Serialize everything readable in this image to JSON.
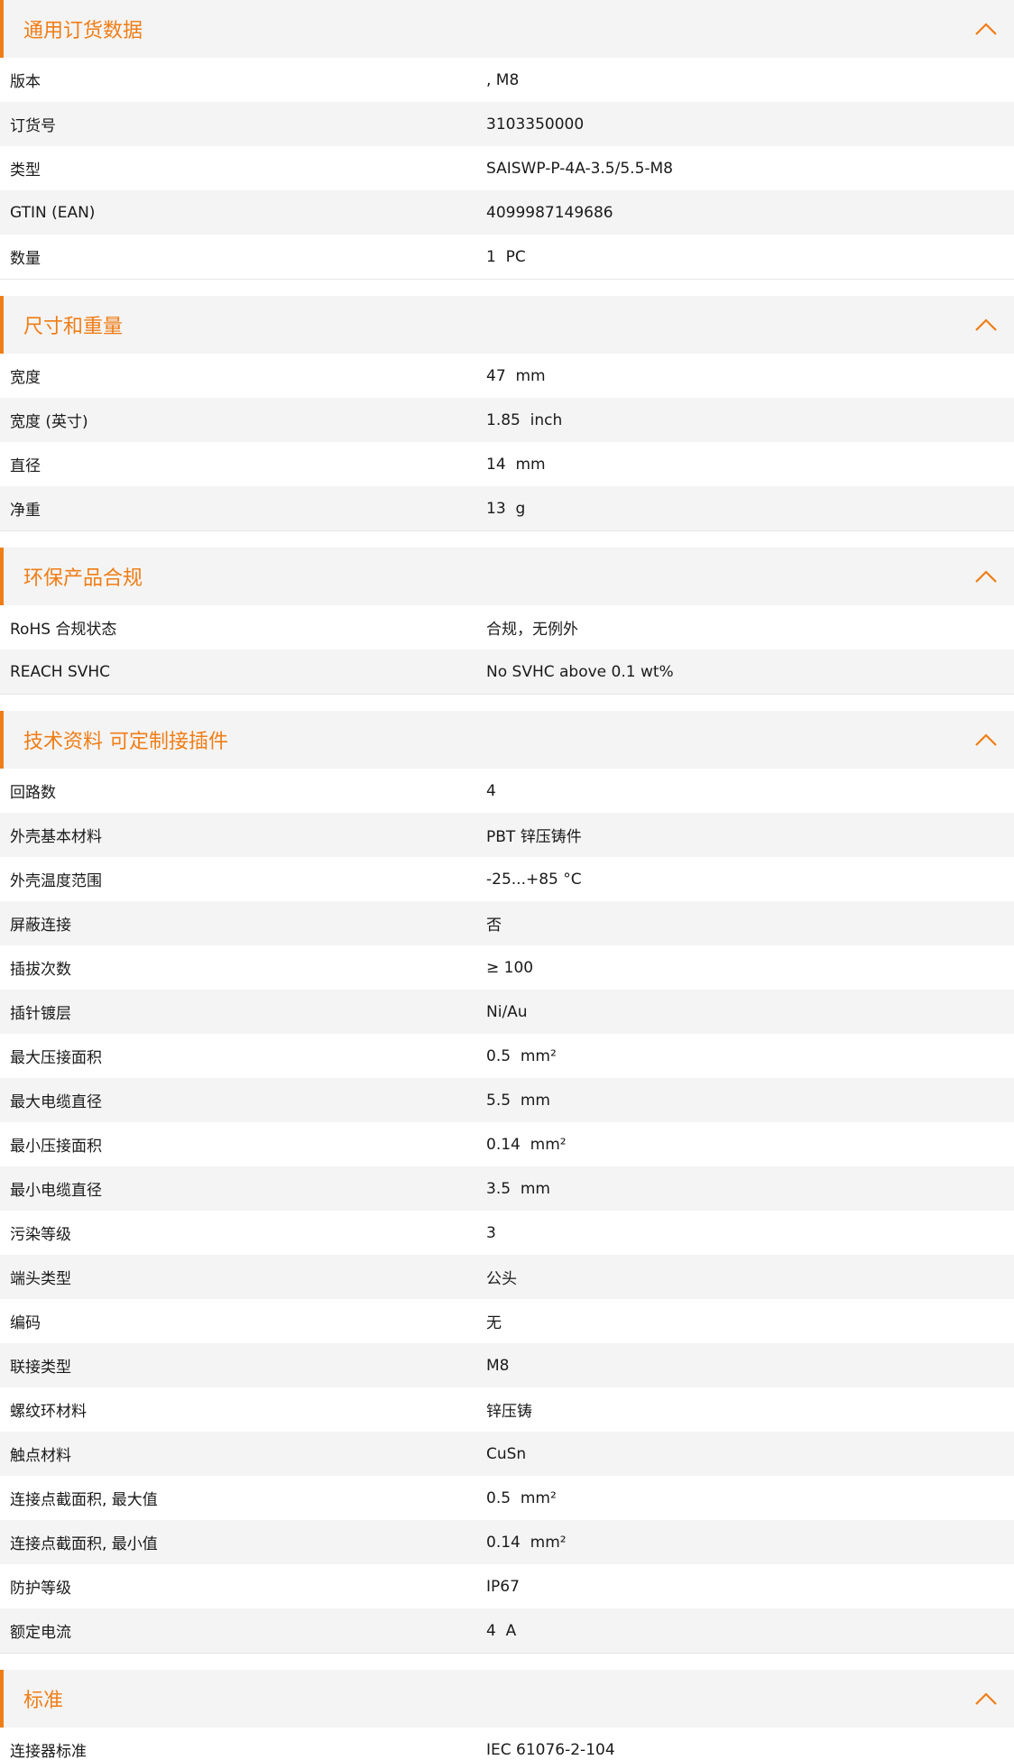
{
  "sections": [
    {
      "title": "通用订货数据",
      "rows": [
        {
          "label": "版本",
          "value": ", M8"
        },
        {
          "label": "订货号",
          "value": "3103350000"
        },
        {
          "label": "类型",
          "value": "SAISWP-P-4A-3.5/5.5-M8"
        },
        {
          "label": "GTIN (EAN)",
          "value": "4099987149686"
        },
        {
          "label": "数量",
          "value": "1  PC"
        }
      ]
    },
    {
      "title": "尺寸和重量",
      "rows": [
        {
          "label": "宽度",
          "value": "47  mm"
        },
        {
          "label": "宽度 (英寸)",
          "value": "1.85  inch"
        },
        {
          "label": "直径",
          "value": "14  mm"
        },
        {
          "label": "净重",
          "value": "13  g"
        }
      ]
    },
    {
      "title": "环保产品合规",
      "rows": [
        {
          "label": "RoHS 合规状态",
          "value": "合规，无例外"
        },
        {
          "label": "REACH SVHC",
          "value": "No SVHC above 0.1 wt%"
        }
      ]
    },
    {
      "title": "技术资料 可定制接插件",
      "rows": [
        {
          "label": "回路数",
          "value": "4"
        },
        {
          "label": "外壳基本材料",
          "value": "PBT 锌压铸件"
        },
        {
          "label": "外壳温度范围",
          "value": "-25...+85 °C"
        },
        {
          "label": "屏蔽连接",
          "value": "否"
        },
        {
          "label": "插拔次数",
          "value": "≥ 100"
        },
        {
          "label": "插针镀层",
          "value": "Ni/Au"
        },
        {
          "label": "最大压接面积",
          "value": "0.5  mm²"
        },
        {
          "label": "最大电缆直径",
          "value": "5.5  mm"
        },
        {
          "label": "最小压接面积",
          "value": "0.14  mm²"
        },
        {
          "label": "最小电缆直径",
          "value": "3.5  mm"
        },
        {
          "label": "污染等级",
          "value": "3"
        },
        {
          "label": "端头类型",
          "value": "公头"
        },
        {
          "label": "编码",
          "value": "无"
        },
        {
          "label": "联接类型",
          "value": "M8"
        },
        {
          "label": "螺纹环材料",
          "value": "锌压铸"
        },
        {
          "label": "触点材料",
          "value": "CuSn"
        },
        {
          "label": "连接点截面积, 最大值",
          "value": "0.5  mm²"
        },
        {
          "label": "连接点截面积, 最小值",
          "value": "0.14  mm²"
        },
        {
          "label": "防护等级",
          "value": "IP67"
        },
        {
          "label": "额定电流",
          "value": "4  A"
        }
      ]
    },
    {
      "title": "标准",
      "rows": [
        {
          "label": "连接器标准",
          "value": "IEC 61076-2-104"
        }
      ]
    }
  ],
  "icons": {
    "section_toggle": "chevron-up-icon"
  },
  "colors": {
    "accent": "#f07d16",
    "row_alt": "#f4f4f4"
  }
}
